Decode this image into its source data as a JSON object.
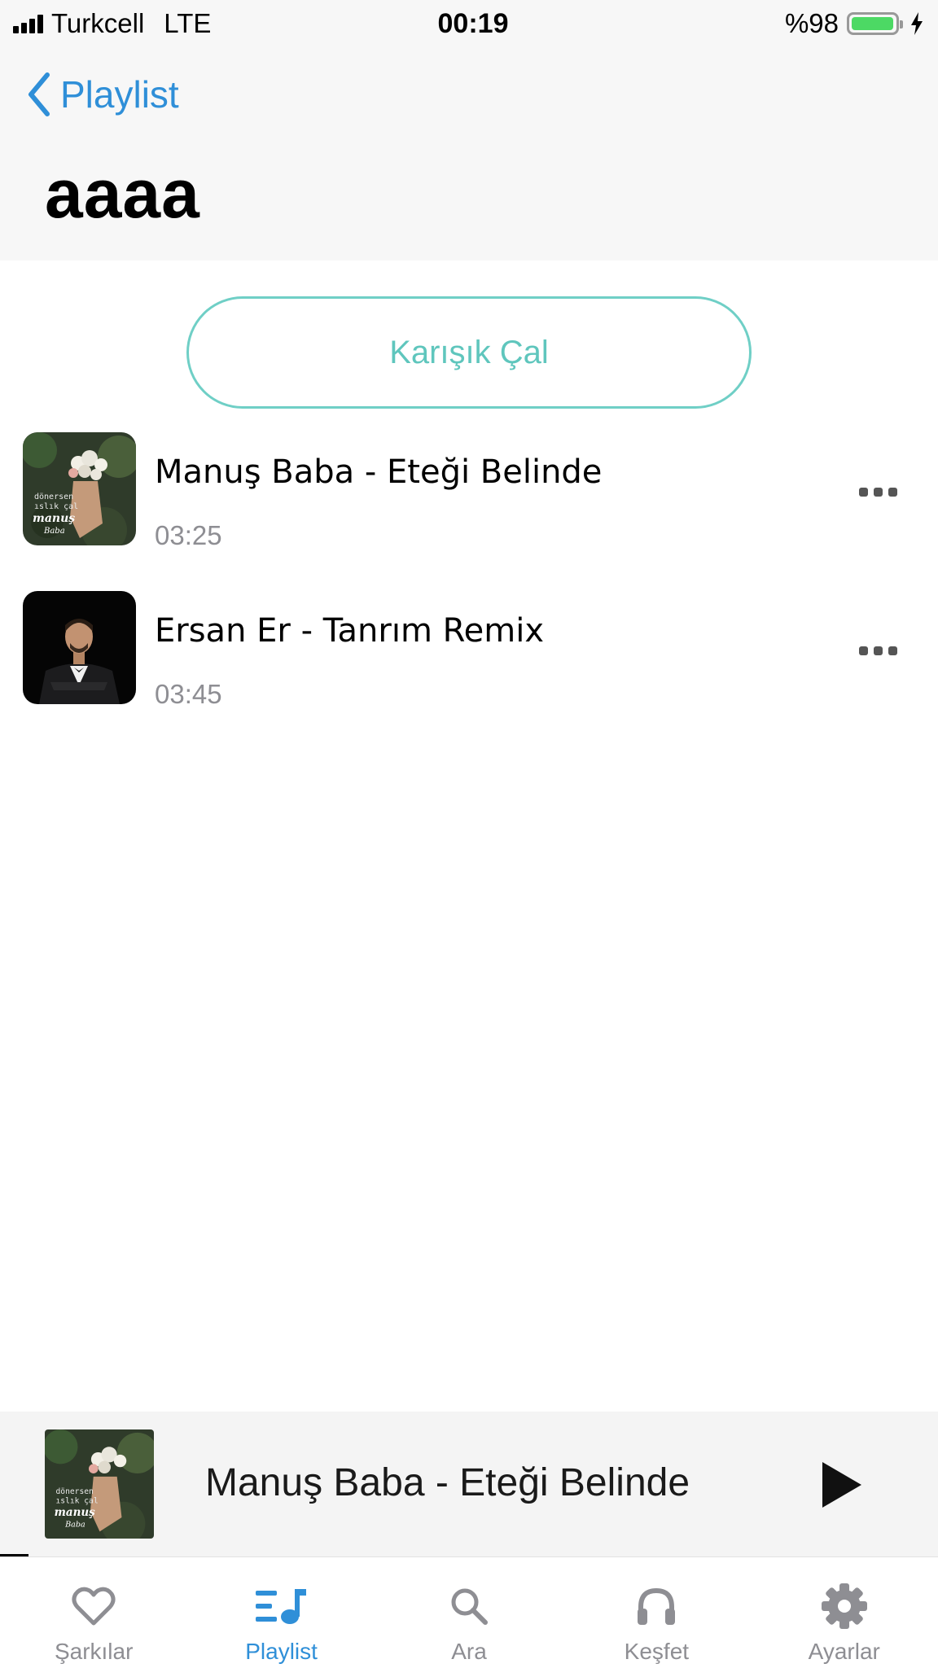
{
  "status_bar": {
    "carrier": "Turkcell",
    "network": "LTE",
    "time": "00:19",
    "battery": "%98",
    "battery_level": 0.98
  },
  "nav": {
    "back_label": "Playlist",
    "title": "aaaa"
  },
  "shuffle_label": "Karışık Çal",
  "songs": [
    {
      "title": "Manuş Baba - Eteği Belinde",
      "duration": "03:25"
    },
    {
      "title": "Ersan Er - Tanrım Remix",
      "duration": "03:45"
    }
  ],
  "now_playing": {
    "title": "Manuş Baba - Eteği Belinde",
    "progress": 0.03
  },
  "album_art_text": [
    "dönersen",
    "ıslık çal",
    "manuş",
    "Baba"
  ],
  "tabs": [
    {
      "label": "Şarkılar",
      "icon": "heart-icon"
    },
    {
      "label": "Playlist",
      "icon": "playlist-icon"
    },
    {
      "label": "Ara",
      "icon": "search-icon"
    },
    {
      "label": "Keşfet",
      "icon": "headphones-icon"
    },
    {
      "label": "Ayarlar",
      "icon": "gear-icon"
    }
  ],
  "colors": {
    "accent": "#2f8fd8",
    "shuffle": "#5fc6bd",
    "battery": "#4cd964",
    "inactive_tab": "#8e8e93"
  }
}
